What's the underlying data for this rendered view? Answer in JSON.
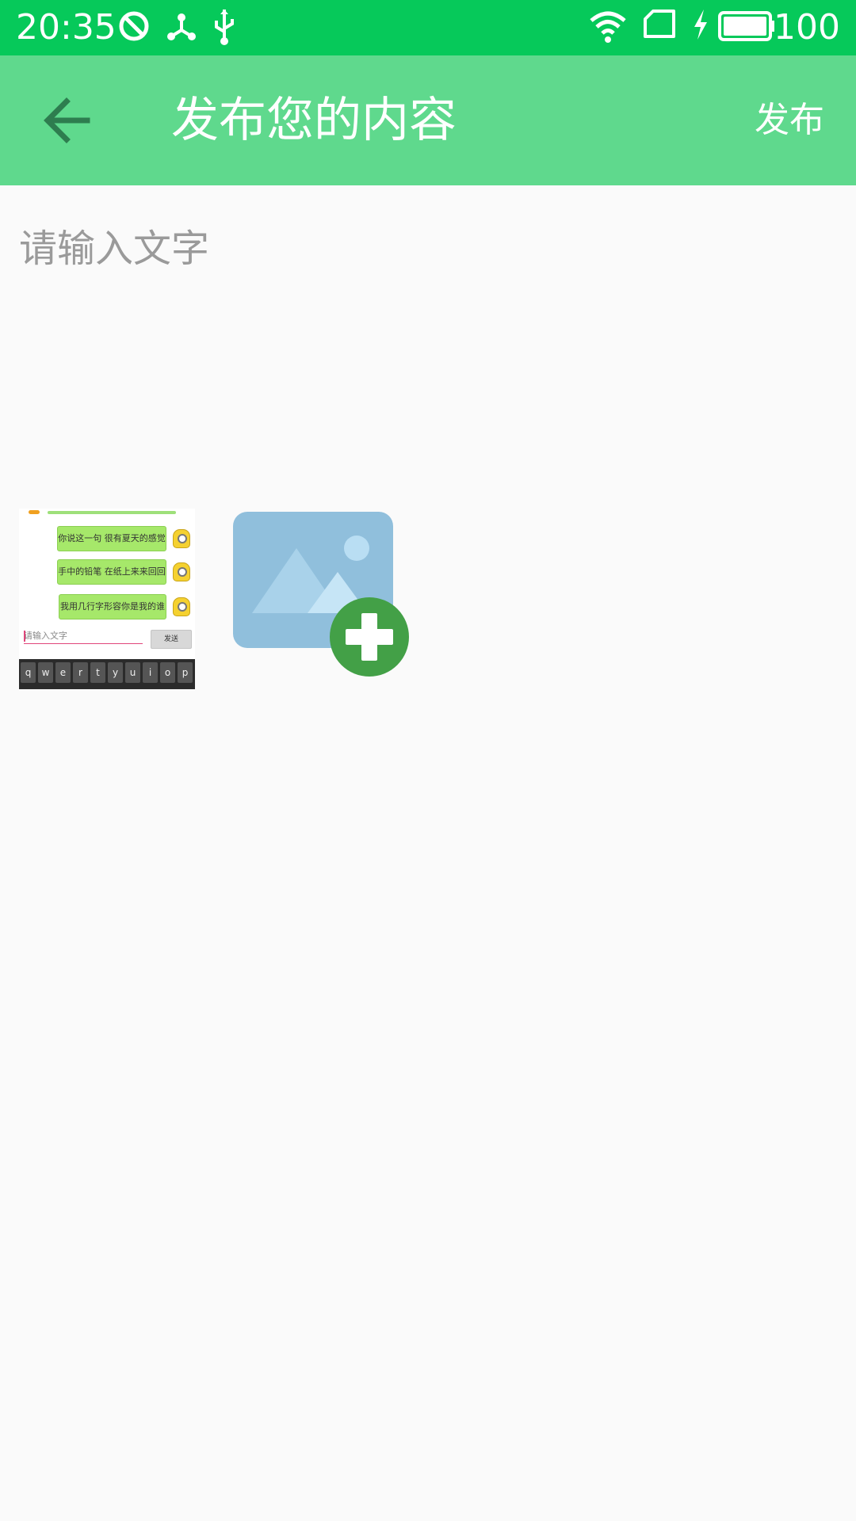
{
  "status_bar": {
    "time": "20:35",
    "battery": "100",
    "icons": [
      "do-not-disturb-icon",
      "share-node-icon",
      "usb-icon",
      "wifi-icon",
      "sim-icon",
      "charging-icon",
      "battery-icon"
    ]
  },
  "app_bar": {
    "title": "发布您的内容",
    "back_icon": "arrow-back-icon",
    "publish_label": "发布"
  },
  "editor": {
    "placeholder": "请输入文字",
    "value": ""
  },
  "images": {
    "thumbnail": {
      "messages": [
        "你说这一句 很有夏天的感觉",
        "手中的铅笔 在纸上来来回回",
        "我用几行字形容你是我的谁"
      ],
      "input_placeholder": "请输入文字",
      "send_label": "发送",
      "keys": [
        "q",
        "w",
        "e",
        "r",
        "t",
        "y",
        "u",
        "i",
        "o",
        "p"
      ]
    },
    "add_button_icon": "add-image-icon"
  },
  "colors": {
    "status_bar": "#06c95a",
    "app_bar": "#5fd98d",
    "back_arrow": "#2e7d4f",
    "image_placeholder": "#90bfdc",
    "add_badge": "#43a047"
  }
}
